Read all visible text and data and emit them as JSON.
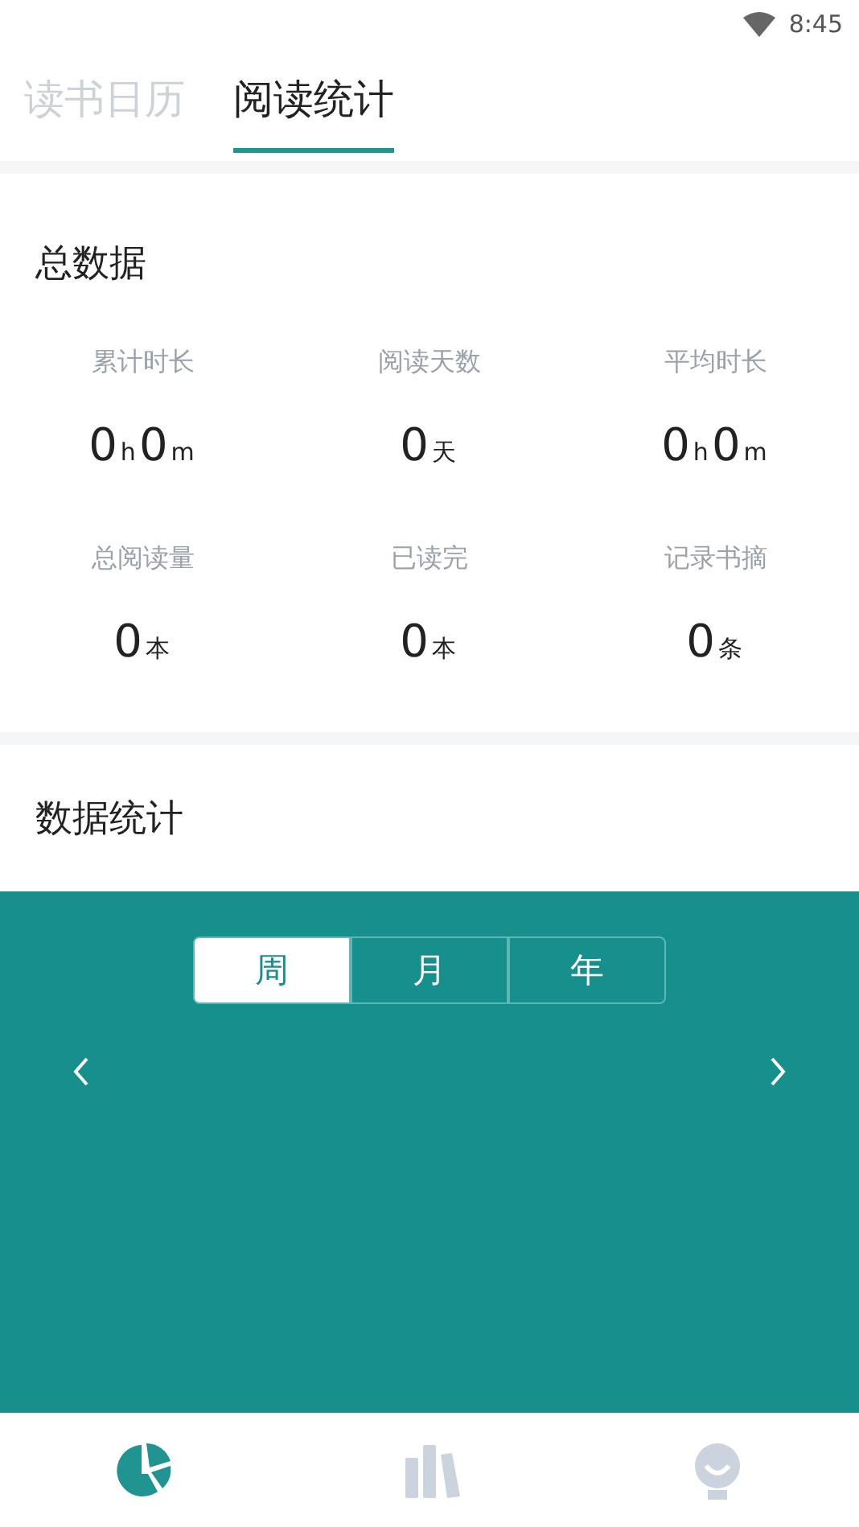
{
  "status_bar": {
    "time": "8:45"
  },
  "tabs": [
    {
      "label": "读书日历",
      "selected": false
    },
    {
      "label": "阅读统计",
      "selected": true
    }
  ],
  "summary": {
    "title": "总数据",
    "stats": [
      {
        "label": "累计时长",
        "parts": [
          {
            "num": "0",
            "unit": "h"
          },
          {
            "num": "0",
            "unit": "m"
          }
        ]
      },
      {
        "label": "阅读天数",
        "parts": [
          {
            "num": "0",
            "unit": "天"
          }
        ]
      },
      {
        "label": "平均时长",
        "parts": [
          {
            "num": "0",
            "unit": "h"
          },
          {
            "num": "0",
            "unit": "m"
          }
        ]
      },
      {
        "label": "总阅读量",
        "parts": [
          {
            "num": "0",
            "unit": "本"
          }
        ]
      },
      {
        "label": "已读完",
        "parts": [
          {
            "num": "0",
            "unit": "本"
          }
        ]
      },
      {
        "label": "记录书摘",
        "parts": [
          {
            "num": "0",
            "unit": "条"
          }
        ]
      }
    ]
  },
  "data_stats": {
    "title": "数据统计",
    "periods": [
      {
        "label": "周",
        "selected": true
      },
      {
        "label": "月",
        "selected": false
      },
      {
        "label": "年",
        "selected": false
      }
    ]
  },
  "bottom_nav": [
    {
      "kind": "pie",
      "selected": true
    },
    {
      "kind": "books",
      "selected": false
    },
    {
      "kind": "profile",
      "selected": false
    }
  ]
}
